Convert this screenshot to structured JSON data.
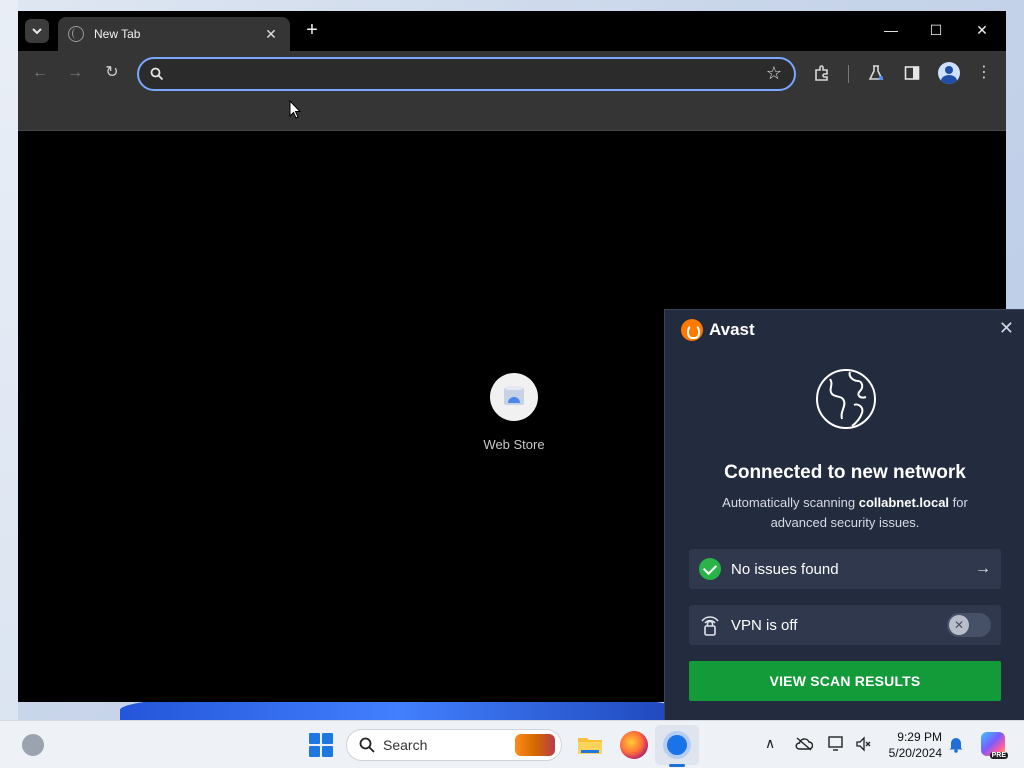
{
  "browser": {
    "tab_title": "New Tab",
    "omnibox_value": "",
    "page": {
      "shortcut_label": "Web Store"
    }
  },
  "avast": {
    "brand": "Avast",
    "title": "Connected to new network",
    "desc_prefix": "Automatically scanning ",
    "network_name": "collabnet.local",
    "desc_suffix": " for advanced security issues.",
    "status_label": "No issues found",
    "vpn_label": "VPN is off",
    "vpn_enabled": false,
    "scan_button": "VIEW SCAN RESULTS",
    "colors": {
      "accent_orange": "#ff7800",
      "success_green": "#28b446",
      "button_green": "#139b3a",
      "panel_bg": "#232b3e"
    }
  },
  "taskbar": {
    "search_label": "Search",
    "time": "9:29 PM",
    "date": "5/20/2024",
    "copilot_badge": "PRE"
  }
}
